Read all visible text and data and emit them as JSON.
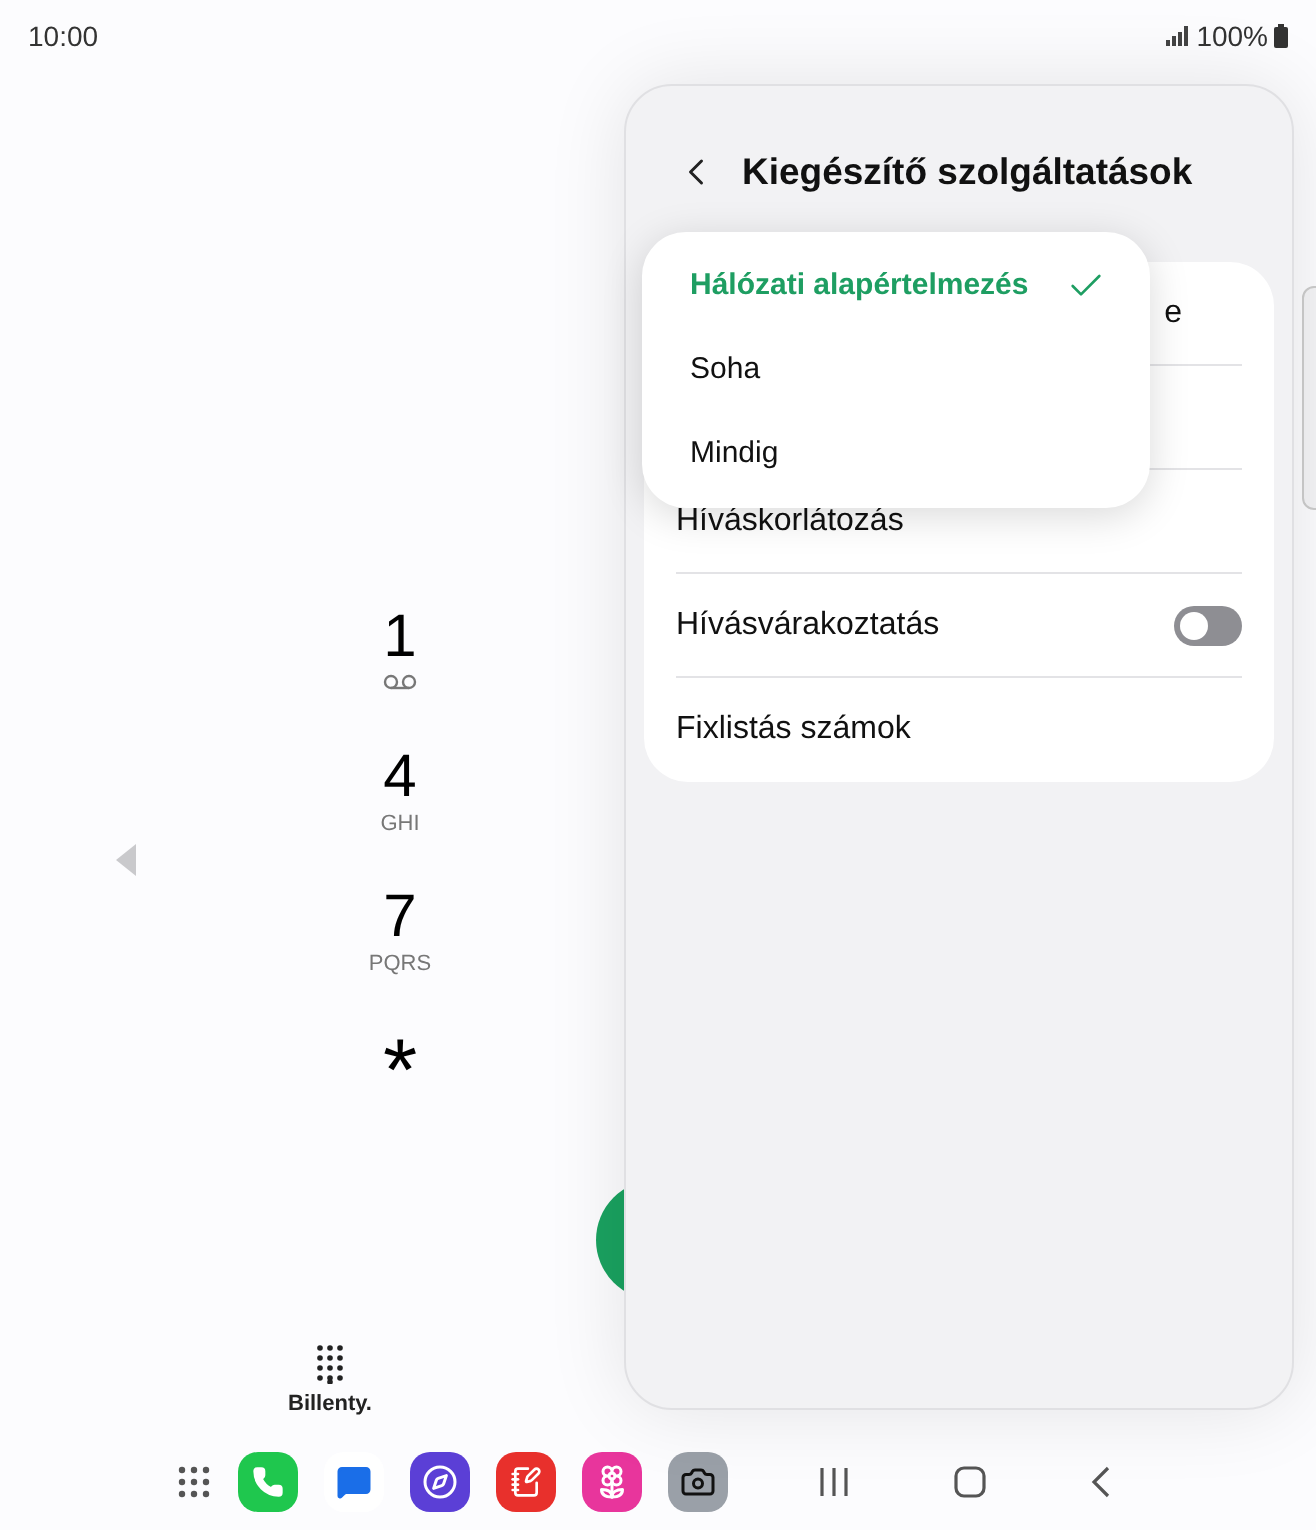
{
  "status_bar": {
    "time": "10:00",
    "battery": "100%"
  },
  "dialer": {
    "keys": [
      {
        "digit": "1",
        "kind": "voicemail"
      },
      {
        "digit": "4",
        "letters": "GHI",
        "kind": "letters"
      },
      {
        "digit": "7",
        "letters": "PQRS",
        "kind": "letters"
      },
      {
        "digit": "*",
        "kind": "star"
      }
    ],
    "tabs": [
      {
        "label": "Billenty.",
        "selected": true
      }
    ]
  },
  "panel": {
    "title": "Kiegészítő szolgáltatások",
    "rows": [
      {
        "kind": "covered",
        "label": "e"
      },
      {
        "kind": "hidden"
      },
      {
        "kind": "plain",
        "label": "Híváskorlátozás"
      },
      {
        "kind": "toggle",
        "label": "Hívásvárakoztatás",
        "on": false
      },
      {
        "kind": "plain",
        "label": "Fixlistás számok"
      }
    ],
    "dropdown": [
      {
        "label": "Hálózati alapértelmezés",
        "selected": true
      },
      {
        "label": "Soha",
        "selected": false
      },
      {
        "label": "Mindig",
        "selected": false
      }
    ]
  }
}
